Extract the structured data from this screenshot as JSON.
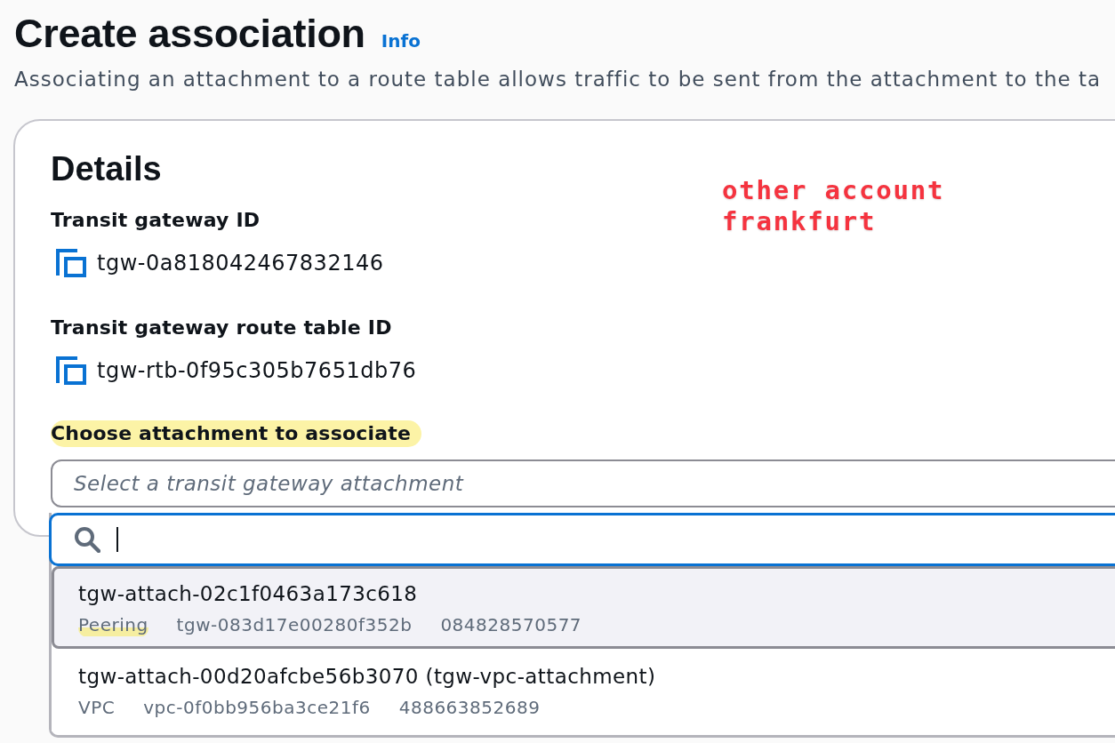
{
  "page": {
    "title": "Create association",
    "info_link": "Info",
    "description": "Associating an attachment to a route table allows traffic to be sent from the attachment to the ta"
  },
  "annotation": {
    "lines": [
      "other account",
      "frankfurt"
    ]
  },
  "details": {
    "heading": "Details",
    "fields": [
      {
        "label": "Transit gateway ID",
        "value": "tgw-0a818042467832146"
      },
      {
        "label": "Transit gateway route table ID",
        "value": "tgw-rtb-0f95c305b7651db76"
      }
    ]
  },
  "attachment": {
    "label": "Choose attachment to associate",
    "label_highlighted": true,
    "placeholder": "Select a transit gateway attachment",
    "search": {
      "focused": true
    },
    "options": [
      {
        "title": "tgw-attach-02c1f0463a173c618",
        "selected": true,
        "tags": [
          {
            "text": "Peering",
            "highlighted": true
          },
          {
            "text": "tgw-083d17e00280f352b",
            "highlighted": false
          },
          {
            "text": "084828570577",
            "highlighted": false
          }
        ]
      },
      {
        "title": "tgw-attach-00d20afcbe56b3070 (tgw-vpc-attachment)",
        "selected": false,
        "tags": [
          {
            "text": "VPC",
            "highlighted": false
          },
          {
            "text": "vpc-0f0bb956ba3ce21f6",
            "highlighted": false
          },
          {
            "text": "488663852689",
            "highlighted": false
          }
        ]
      }
    ]
  }
}
